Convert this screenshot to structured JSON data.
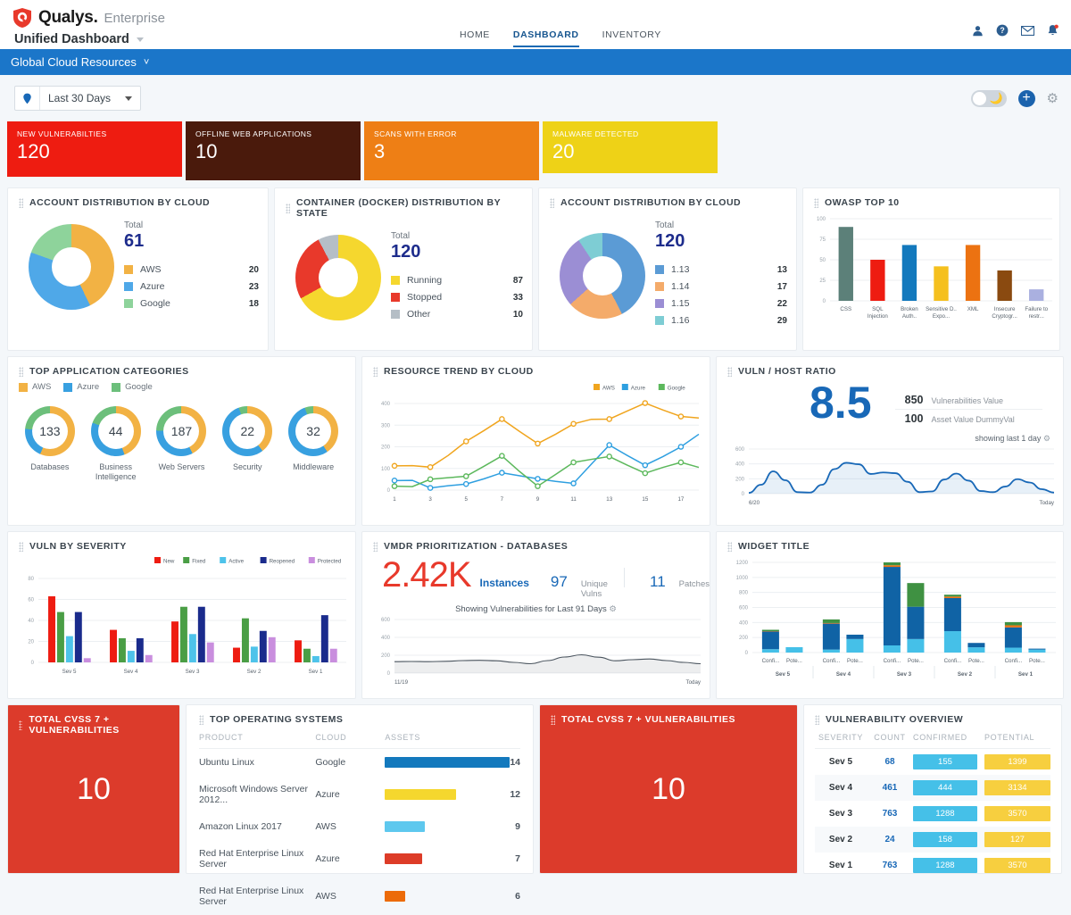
{
  "header": {
    "brand_name": "Qualys.",
    "brand_edition": "Enterprise",
    "dashboard_title": "Unified Dashboard",
    "nav": [
      {
        "label": "HOME",
        "active": false
      },
      {
        "label": "DASHBOARD",
        "active": true
      },
      {
        "label": "INVENTORY",
        "active": false
      }
    ],
    "icons": [
      "user-icon",
      "help-icon",
      "mail-icon",
      "notification-icon"
    ]
  },
  "breadcrumb": {
    "label": "Global Cloud Resources"
  },
  "toolbar": {
    "filter_icon": "tag-icon",
    "date_range": "Last 30 Days",
    "dark_mode_icon": "moon-icon",
    "add_icon": "plus-icon",
    "settings_icon": "gear-icon"
  },
  "kpis": [
    {
      "label": "NEW VULNERABILTIES",
      "value": "120",
      "color": "#ee1c11"
    },
    {
      "label": "OFFLINE WEB APPLICATIONS",
      "value": "10",
      "color": "#4a1a0c"
    },
    {
      "label": "SCANS WITH ERROR",
      "value": "3",
      "color": "#ee7f15"
    },
    {
      "label": "MALWARE DETECTED",
      "value": "20",
      "color": "#eed217"
    }
  ],
  "widgets": {
    "account_distribution_1": {
      "title": "ACCOUNT DISTRIBUTION BY CLOUD",
      "total_label": "Total",
      "total": "61",
      "legend": [
        {
          "name": "AWS",
          "value": "20",
          "color": "#f2b244"
        },
        {
          "name": "Azure",
          "value": "23",
          "color": "#4fa8e8"
        },
        {
          "name": "Google",
          "value": "18",
          "color": "#8ed39b"
        }
      ]
    },
    "container_distribution": {
      "title": "CONTAINER (DOCKER) DISTRIBUTION BY STATE",
      "total_label": "Total",
      "total": "120",
      "legend": [
        {
          "name": "Running",
          "value": "87",
          "color": "#f5d72e"
        },
        {
          "name": "Stopped",
          "value": "33",
          "color": "#e8392b"
        },
        {
          "name": "Other",
          "value": "10",
          "color": "#b5bec6"
        }
      ]
    },
    "account_distribution_2": {
      "title": "ACCOUNT DISTRIBUTION BY CLOUD",
      "total_label": "Total",
      "total": "120",
      "legend": [
        {
          "name": "1.13",
          "value": "13",
          "color": "#5b9bd5"
        },
        {
          "name": "1.14",
          "value": "17",
          "color": "#f4ab6a"
        },
        {
          "name": "1.15",
          "value": "22",
          "color": "#9b8ed4"
        },
        {
          "name": "1.16",
          "value": "29",
          "color": "#7ecdd4"
        }
      ]
    },
    "owasp": {
      "title": "OWASP TOP 10"
    },
    "top_app_categories": {
      "title": "TOP APPLICATION CATEGORIES",
      "legend": [
        {
          "name": "AWS",
          "color": "#f2b244"
        },
        {
          "name": "Azure",
          "color": "#38a0e0"
        },
        {
          "name": "Google",
          "color": "#6cbf7b"
        }
      ],
      "items": [
        {
          "value": "133",
          "label": "Databases"
        },
        {
          "value": "44",
          "label": "Business Intelligence"
        },
        {
          "value": "187",
          "label": "Web Servers"
        },
        {
          "value": "22",
          "label": "Security"
        },
        {
          "value": "32",
          "label": "Middleware"
        }
      ]
    },
    "resource_trend": {
      "title": "RESOURCE TREND BY CLOUD"
    },
    "vuln_host_ratio": {
      "title": "VULN / HOST RATIO",
      "ratio": "8.5",
      "stats": [
        {
          "value": "850",
          "label": "Vulnerabilities Value"
        },
        {
          "value": "100",
          "label": "Asset Value  DummyVal"
        }
      ],
      "showing": "showing last 1 day",
      "start_label": "6/20",
      "end_label": "Today"
    },
    "vuln_by_severity": {
      "title": "VULN BY SEVERITY"
    },
    "vmdr": {
      "title": "VMDR PRIORITIZATION - DATABASES",
      "instances_value": "2.42K",
      "instances_label": "Instances",
      "unique_value": "97",
      "unique_label": "Unique Vulns",
      "patches_value": "11",
      "patches_label": "Patches",
      "showing": "Showing Vulnerabilities for Last 91 Days",
      "start_label": "11/19",
      "end_label": "Today"
    },
    "widget_title": {
      "title": "WIDGET TITLE"
    },
    "total_cvss_left": {
      "title": "TOTAL CVSS 7 + VULNERABILITIES",
      "value": "10"
    },
    "total_cvss_right": {
      "title": "TOTAL CVSS 7 + VULNERABILITIES",
      "value": "10"
    },
    "top_os": {
      "title": "TOP OPERATING SYSTEMS",
      "columns": [
        "PRODUCT",
        "CLOUD",
        "ASSETS"
      ],
      "rows": [
        {
          "product": "Ubuntu Linux",
          "cloud": "Google",
          "assets": "14",
          "bar_pct": 100,
          "color": "#1379bd"
        },
        {
          "product": "Microsoft Windows Server 2012...",
          "cloud": "Azure",
          "assets": "12",
          "bar_pct": 57,
          "color": "#f5d72e"
        },
        {
          "product": "Amazon Linux 2017",
          "cloud": "AWS",
          "assets": "9",
          "bar_pct": 32,
          "color": "#5ec8ee"
        },
        {
          "product": "Red Hat Enterprise Linux Server",
          "cloud": "Azure",
          "assets": "7",
          "bar_pct": 30,
          "color": "#dd3c28"
        },
        {
          "product": "Red Hat Enterprise Linux Server",
          "cloud": "AWS",
          "assets": "6",
          "bar_pct": 16,
          "color": "#ec6b09"
        }
      ]
    },
    "vuln_overview": {
      "title": "VULNERABILITY OVERVIEW",
      "columns": [
        "SEVERITY",
        "COUNT",
        "CONFIRMED",
        "POTENTIAL"
      ],
      "rows": [
        {
          "severity": "Sev 5",
          "count": "68",
          "confirmed": "155",
          "potential": "1399"
        },
        {
          "severity": "Sev 4",
          "count": "461",
          "confirmed": "444",
          "potential": "3134"
        },
        {
          "severity": "Sev 3",
          "count": "763",
          "confirmed": "1288",
          "potential": "3570"
        },
        {
          "severity": "Sev 2",
          "count": "24",
          "confirmed": "158",
          "potential": "127"
        },
        {
          "severity": "Sev 1",
          "count": "763",
          "confirmed": "1288",
          "potential": "3570"
        }
      ],
      "confirmed_color": "#45c0e8",
      "potential_color": "#f7cf3f"
    }
  },
  "chart_data": [
    {
      "id": "owasp",
      "type": "bar",
      "title": "OWASP TOP 10",
      "categories": [
        "CSS",
        "SQL Injection",
        "Broken Auth..",
        "Sensitive Data Expo...",
        "XML",
        "Insecure Cryptogr...",
        "Failure to restr..."
      ],
      "values": [
        90,
        50,
        68,
        42,
        68,
        37,
        14
      ],
      "colors": [
        "#5c8079",
        "#ee1c11",
        "#1379bd",
        "#f5c01e",
        "#ec7211",
        "#8a4a10",
        "#aab0e0"
      ],
      "ylim": [
        0,
        100
      ],
      "yticks": [
        0,
        25,
        50,
        75,
        100
      ],
      "xlabel": "",
      "ylabel": "",
      "grid": true
    },
    {
      "id": "resource_trend",
      "type": "line",
      "title": "RESOURCE TREND BY CLOUD",
      "x": [
        1,
        2,
        3,
        4,
        5,
        6,
        7,
        8,
        9,
        10,
        11,
        12,
        13,
        14,
        15,
        16,
        17,
        18
      ],
      "xticks": [
        1,
        3,
        5,
        7,
        9,
        11,
        13,
        15,
        17
      ],
      "series": [
        {
          "name": "AWS",
          "color": "#f0a51e",
          "values": [
            112,
            113,
            106,
            160,
            225,
            275,
            328,
            270,
            215,
            258,
            306,
            327,
            328,
            365,
            402,
            370,
            340,
            333
          ]
        },
        {
          "name": "Azure",
          "color": "#2e9fe0",
          "values": [
            44,
            45,
            10,
            20,
            28,
            52,
            80,
            66,
            52,
            40,
            31,
            120,
            208,
            160,
            115,
            155,
            200,
            258
          ]
        },
        {
          "name": "Google",
          "color": "#5cb85c",
          "values": [
            18,
            16,
            50,
            57,
            64,
            110,
            158,
            85,
            18,
            72,
            128,
            142,
            155,
            115,
            78,
            105,
            128,
            105
          ]
        }
      ],
      "ylim": [
        0,
        400
      ],
      "yticks": [
        0,
        100,
        200,
        300,
        400
      ],
      "legend_position": "top-right",
      "grid": true
    },
    {
      "id": "vuln_host_ratio_area",
      "type": "area",
      "title": "VULN / HOST RATIO",
      "color": "#1868b7",
      "values": [
        10,
        120,
        300,
        180,
        20,
        15,
        120,
        330,
        415,
        395,
        265,
        285,
        275,
        160,
        20,
        30,
        190,
        270,
        175,
        35,
        20,
        95,
        195,
        150,
        60,
        15
      ],
      "ylim": [
        0,
        600
      ],
      "yticks": [
        0,
        200,
        400,
        600
      ],
      "xlabels": [
        "6/20",
        "Today"
      ],
      "grid": true
    },
    {
      "id": "vuln_by_severity",
      "type": "bar",
      "title": "VULN BY SEVERITY",
      "categories": [
        "Sev 5",
        "Sev 4",
        "Sev 3",
        "Sev 2",
        "Sev 1"
      ],
      "series": [
        {
          "name": "New",
          "color": "#ee1c11",
          "values": [
            63,
            31,
            39,
            14,
            21
          ]
        },
        {
          "name": "Fixed",
          "color": "#4a9e45",
          "values": [
            48,
            23,
            53,
            42,
            13
          ]
        },
        {
          "name": "Active",
          "color": "#4ec3ea",
          "values": [
            25,
            11,
            27,
            15,
            6
          ]
        },
        {
          "name": "Reopened",
          "color": "#1a2b8c",
          "values": [
            48,
            23,
            53,
            30,
            45
          ]
        },
        {
          "name": "Protected",
          "color": "#c98ede",
          "values": [
            4,
            7,
            19,
            24,
            13
          ]
        }
      ],
      "ylim": [
        0,
        80
      ],
      "yticks": [
        0,
        20,
        40,
        60,
        80
      ],
      "legend_position": "top-right",
      "grid": true
    },
    {
      "id": "vmdr_trend",
      "type": "area",
      "title": "VMDR PRIORITIZATION - DATABASES",
      "color": "#4a545e",
      "values": [
        128,
        130,
        128,
        132,
        140,
        143,
        138,
        120,
        105,
        140,
        180,
        205,
        178,
        138,
        150,
        158,
        140,
        120,
        105
      ],
      "ylim": [
        0,
        600
      ],
      "yticks": [
        0,
        200,
        400,
        600
      ],
      "xlabels": [
        "11/19",
        "Today"
      ],
      "grid": true
    },
    {
      "id": "widget_title_stacked",
      "type": "bar",
      "title": "WIDGET TITLE",
      "categories": [
        "Sev 5",
        "Sev 4",
        "Sev 3",
        "Sev 2",
        "Sev 1"
      ],
      "subcategories": [
        "Confi...",
        "Pote..."
      ],
      "stack_names": [
        "light-blue",
        "dark-blue",
        "orange",
        "green"
      ],
      "stack_colors": [
        "#45c0e8",
        "#1063a5",
        "#ec7211",
        "#3f9142"
      ],
      "bars": [
        {
          "group": "Sev 5",
          "sub": "Confi...",
          "segments": [
            45,
            235,
            5,
            18
          ]
        },
        {
          "group": "Sev 5",
          "sub": "Pote...",
          "segments": [
            72,
            0,
            0,
            0
          ]
        },
        {
          "group": "Sev 4",
          "sub": "Confi...",
          "segments": [
            40,
            345,
            8,
            48
          ]
        },
        {
          "group": "Sev 4",
          "sub": "Pote...",
          "segments": [
            180,
            58,
            0,
            0
          ]
        },
        {
          "group": "Sev 3",
          "sub": "Confi...",
          "segments": [
            95,
            1045,
            22,
            38
          ]
        },
        {
          "group": "Sev 3",
          "sub": "Pote...",
          "segments": [
            180,
            430,
            0,
            315
          ]
        },
        {
          "group": "Sev 2",
          "sub": "Confi...",
          "segments": [
            285,
            440,
            20,
            25
          ]
        },
        {
          "group": "Sev 2",
          "sub": "Pote...",
          "segments": [
            70,
            58,
            0,
            0
          ]
        },
        {
          "group": "Sev 1",
          "sub": "Confi...",
          "segments": [
            65,
            270,
            28,
            42
          ]
        },
        {
          "group": "Sev 1",
          "sub": "Pote...",
          "segments": [
            40,
            12,
            0,
            0
          ]
        }
      ],
      "ylim": [
        0,
        1200
      ],
      "yticks": [
        0,
        200,
        400,
        600,
        800,
        1000,
        1200
      ],
      "grid": true
    }
  ]
}
